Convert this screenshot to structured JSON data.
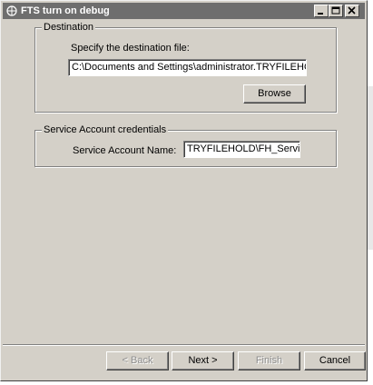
{
  "window": {
    "title": "FTS turn on debug"
  },
  "destination": {
    "group_title": "Destination",
    "prompt": "Specify the destination file:",
    "file_path": "C:\\Documents and Settings\\administrator.TRYFILEHOLD",
    "browse_label": "Browse"
  },
  "service_account": {
    "group_title": "Service Account credentials",
    "name_label": "Service Account Name:",
    "name_value": "TRYFILEHOLD\\FH_Service"
  },
  "footer": {
    "back_label": "< Back",
    "next_label": "Next >",
    "finish_label": "Finish",
    "cancel_label": "Cancel"
  },
  "colors": {
    "face": "#d4d0c8",
    "titlebar": "#6e6e6e",
    "disabled_text": "#8e8e8e"
  }
}
